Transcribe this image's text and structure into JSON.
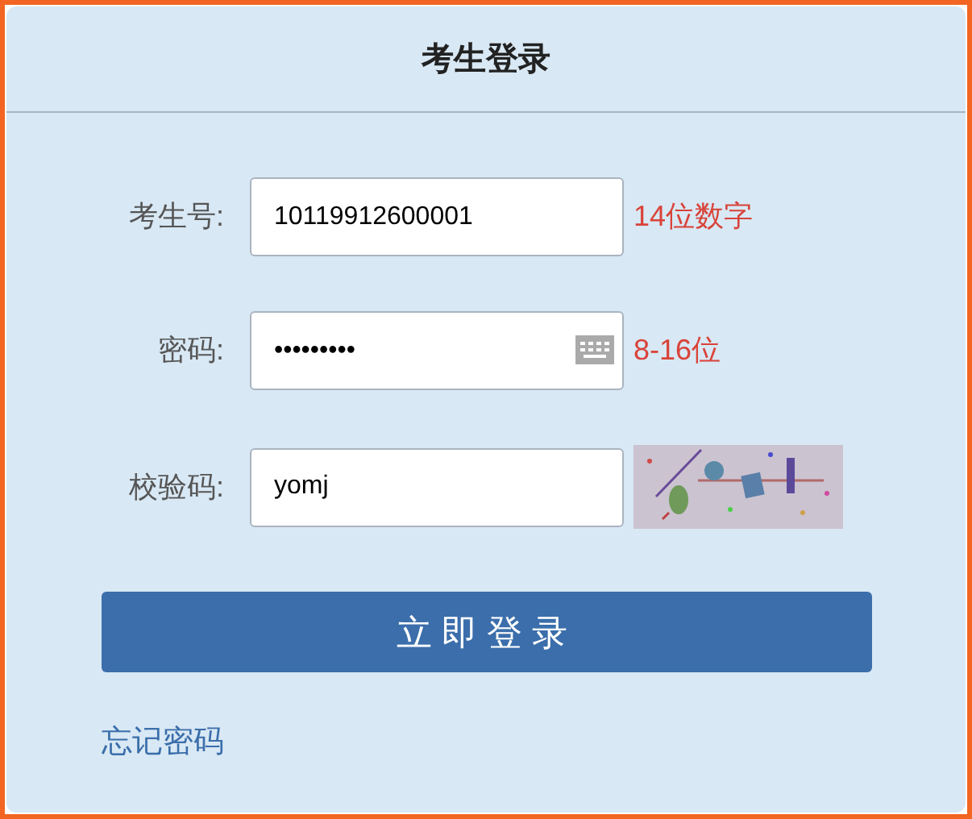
{
  "title": "考生登录",
  "fields": [
    {
      "kind": "text",
      "label": "考生号:",
      "value": "10119912600001",
      "hint": "14位数字"
    },
    {
      "kind": "password",
      "label": "密码:",
      "value": "•••••••••",
      "hint": "8-16位"
    },
    {
      "kind": "captcha",
      "label": "校验码:",
      "value": "yomj"
    }
  ],
  "submit": "立即登录",
  "forgot_link": "忘记密码"
}
